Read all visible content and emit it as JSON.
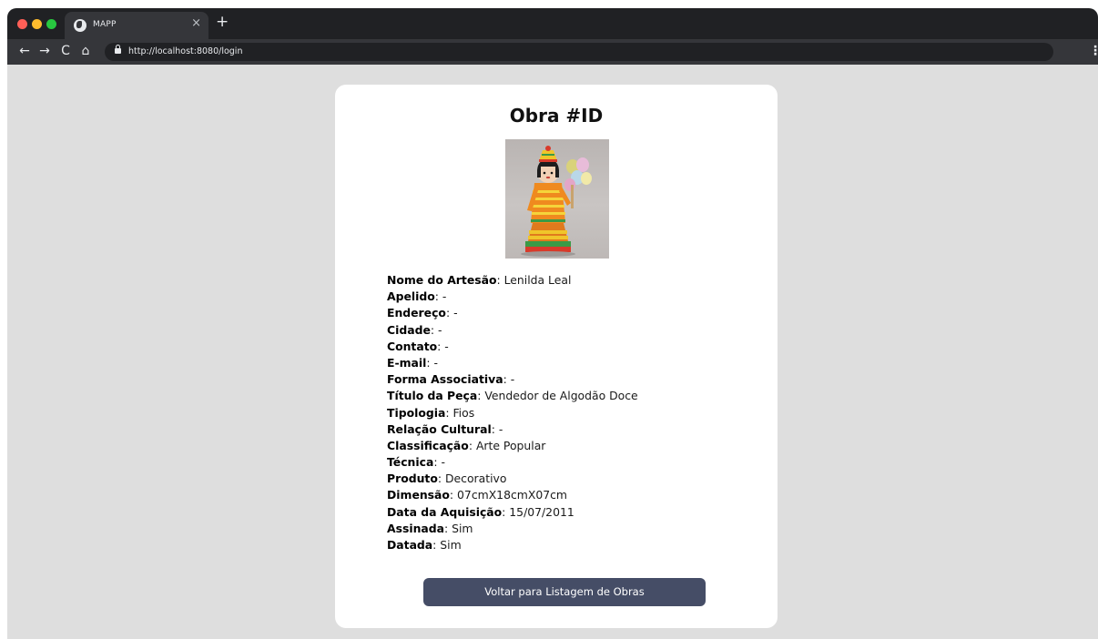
{
  "browser": {
    "tab_title": "MAPP",
    "tab_close": "×",
    "new_tab": "+",
    "url": "http://localhost:8080/login",
    "nav": {
      "back": "←",
      "forward": "→",
      "reload": "C",
      "home": "⌂"
    },
    "menu": "⋮"
  },
  "card": {
    "title": "Obra #ID",
    "image_subject": "crocheted doll figure — Vendedor de Algodão Doce",
    "fields": [
      {
        "label": "Nome do Artesão",
        "value": "Lenilda Leal"
      },
      {
        "label": "Apelido",
        "value": "-"
      },
      {
        "label": "Endereço",
        "value": "-"
      },
      {
        "label": "Cidade",
        "value": "-"
      },
      {
        "label": "Contato",
        "value": "-"
      },
      {
        "label": "E-mail",
        "value": "-"
      },
      {
        "label": "Forma Associativa",
        "value": "-"
      },
      {
        "label": "Título da Peça",
        "value": "Vendedor de Algodão Doce"
      },
      {
        "label": "Tipologia",
        "value": "Fios"
      },
      {
        "label": "Relação Cultural",
        "value": "-"
      },
      {
        "label": "Classificação",
        "value": "Arte Popular"
      },
      {
        "label": "Técnica",
        "value": "-"
      },
      {
        "label": "Produto",
        "value": "Decorativo"
      },
      {
        "label": "Dimensão",
        "value": "07cmX18cmX07cm"
      },
      {
        "label": "Data da Aquisição",
        "value": "15/07/2011"
      },
      {
        "label": "Assinada",
        "value": "Sim"
      },
      {
        "label": "Datada",
        "value": "Sim"
      }
    ],
    "back_button": "Voltar para Listagem de Obras"
  },
  "colors": {
    "page_background": "#dedede",
    "card_background": "#ffffff",
    "button_background": "#454d66",
    "browser_chrome": "#202124"
  }
}
